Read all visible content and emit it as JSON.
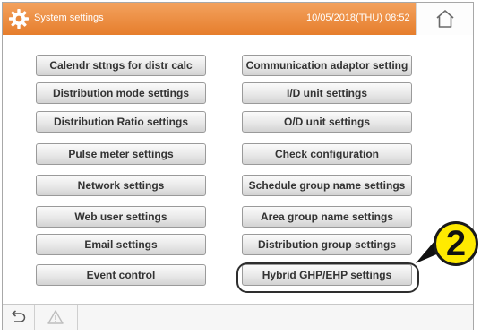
{
  "header": {
    "title": "System settings",
    "datetime": "10/05/2018(THU) 08:52",
    "icons": {
      "app": "gear-icon",
      "home": "home-icon"
    },
    "colors": {
      "bar_top": "#f3a25e",
      "bar_bottom": "#e67e2c"
    }
  },
  "menu": {
    "left": [
      "Calendr sttngs for distr calc",
      "Distribution mode settings",
      "Distribution Ratio settings",
      "Pulse meter settings",
      "Network settings",
      "Web user settings",
      "Email settings",
      "Event control"
    ],
    "right": [
      "Communication adaptor setting",
      "I/D unit settings",
      "O/D unit settings",
      "Check configuration",
      "Schedule group name settings",
      "Area group name settings",
      "Distribution group settings",
      "Hybrid GHP/EHP settings"
    ]
  },
  "callout": {
    "number": "2",
    "color": "#ffea00"
  },
  "footer": {
    "icons": [
      "back-icon",
      "warning-icon"
    ]
  }
}
